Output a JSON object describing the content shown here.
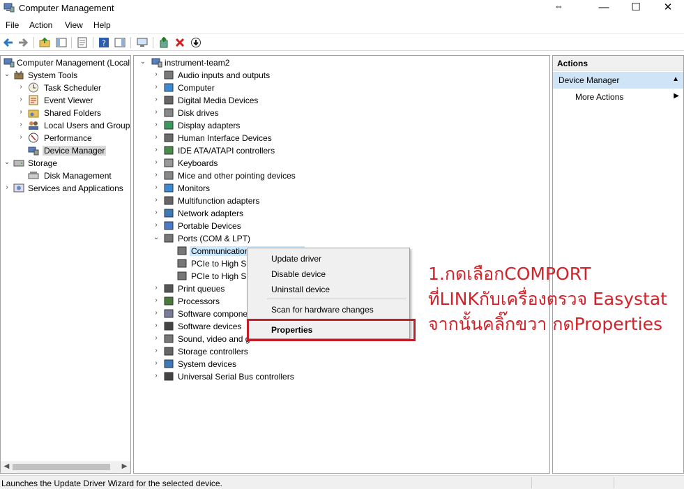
{
  "window": {
    "title": "Computer Management",
    "controls": {
      "minimize": "—",
      "maximize": "☐",
      "close": "✕",
      "resize": "⇔"
    }
  },
  "menubar": {
    "items": [
      "File",
      "Action",
      "View",
      "Help"
    ]
  },
  "toolbar": {
    "icons": [
      "back-arrow-icon",
      "forward-arrow-icon",
      "up-folder-icon",
      "show-hide-tree-icon",
      "properties-icon",
      "help-icon",
      "action-pane-icon",
      "monitor-icon",
      "update-driver-icon",
      "uninstall-icon",
      "disable-icon"
    ]
  },
  "left_tree": {
    "items": [
      {
        "label": "Computer Management (Local",
        "icon": "computer-management-icon",
        "expander": ""
      },
      {
        "label": "System Tools",
        "icon": "tools-icon",
        "expander": "⌄"
      },
      {
        "label": "Task Scheduler",
        "icon": "clock-icon",
        "expander": "›"
      },
      {
        "label": "Event Viewer",
        "icon": "event-viewer-icon",
        "expander": "›"
      },
      {
        "label": "Shared Folders",
        "icon": "shared-folder-icon",
        "expander": "›"
      },
      {
        "label": "Local Users and Groups",
        "icon": "users-icon",
        "expander": "›"
      },
      {
        "label": "Performance",
        "icon": "performance-icon",
        "expander": "›"
      },
      {
        "label": "Device Manager",
        "icon": "device-manager-icon",
        "expander": ""
      },
      {
        "label": "Storage",
        "icon": "storage-icon",
        "expander": "⌄"
      },
      {
        "label": "Disk Management",
        "icon": "disk-icon",
        "expander": ""
      },
      {
        "label": "Services and Applications",
        "icon": "services-icon",
        "expander": "›"
      }
    ]
  },
  "device_tree": {
    "root": "instrument-team2",
    "categories": [
      {
        "label": "Audio inputs and outputs",
        "icon": "speaker-icon",
        "expander": "›"
      },
      {
        "label": "Computer",
        "icon": "computer-icon",
        "expander": "›"
      },
      {
        "label": "Digital Media Devices",
        "icon": "media-device-icon",
        "expander": "›"
      },
      {
        "label": "Disk drives",
        "icon": "disk-drive-icon",
        "expander": "›"
      },
      {
        "label": "Display adapters",
        "icon": "display-adapter-icon",
        "expander": "›"
      },
      {
        "label": "Human Interface Devices",
        "icon": "hid-icon",
        "expander": "›"
      },
      {
        "label": "IDE ATA/ATAPI controllers",
        "icon": "ide-controller-icon",
        "expander": "›"
      },
      {
        "label": "Keyboards",
        "icon": "keyboard-icon",
        "expander": "›"
      },
      {
        "label": "Mice and other pointing devices",
        "icon": "mouse-icon",
        "expander": "›"
      },
      {
        "label": "Monitors",
        "icon": "monitor-icon",
        "expander": "›"
      },
      {
        "label": "Multifunction adapters",
        "icon": "multifunction-icon",
        "expander": "›"
      },
      {
        "label": "Network adapters",
        "icon": "network-adapter-icon",
        "expander": "›"
      },
      {
        "label": "Portable Devices",
        "icon": "portable-device-icon",
        "expander": "›"
      },
      {
        "label": "Ports (COM & LPT)",
        "icon": "port-icon",
        "expander": "⌄"
      }
    ],
    "ports_children": [
      "Communications Port (COM1)",
      "PCIe to High Sp",
      "PCIe to High Sp"
    ],
    "categories_after": [
      {
        "label": "Print queues",
        "icon": "printer-icon",
        "expander": "›"
      },
      {
        "label": "Processors",
        "icon": "processor-icon",
        "expander": "›"
      },
      {
        "label": "Software compone",
        "icon": "software-component-icon",
        "expander": "›"
      },
      {
        "label": "Software devices",
        "icon": "software-device-icon",
        "expander": "›"
      },
      {
        "label": "Sound, video and g",
        "icon": "sound-icon",
        "expander": "›"
      },
      {
        "label": "Storage controllers",
        "icon": "storage-controller-icon",
        "expander": "›"
      },
      {
        "label": "System devices",
        "icon": "system-device-icon",
        "expander": "›"
      },
      {
        "label": "Universal Serial Bus controllers",
        "icon": "usb-icon",
        "expander": "›"
      }
    ]
  },
  "context_menu": {
    "items": [
      "Update driver",
      "Disable device",
      "Uninstall device",
      "Scan for hardware changes",
      "Properties"
    ]
  },
  "actions_pane": {
    "header": "Actions",
    "section": "Device Manager",
    "item": "More Actions"
  },
  "annotation": {
    "lines": [
      "1.กดเลือกCOMPORT",
      "ที่LINKกับเครื่องตรวจ Easystat",
      "จากนั้นคลิ๊กขวา กดProperties"
    ],
    "color": "#d2232a"
  },
  "status": {
    "text": "Launches the Update Driver Wizard for the selected device."
  },
  "colors": {
    "selection": "#cce8ff",
    "actions_section": "#cfe4f6",
    "highlight": "#c0202a"
  }
}
